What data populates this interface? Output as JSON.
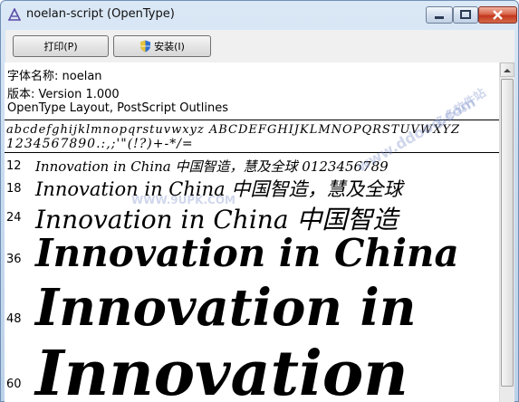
{
  "window": {
    "title": "noelan-script (OpenType)",
    "accent": "#c3361c"
  },
  "toolbar": {
    "print_label": "打印(P)",
    "install_label": "安装(I)"
  },
  "info": {
    "font_name": "字体名称: noelan",
    "version": "版本: Version 1.000",
    "tech": "OpenType Layout, PostScript Outlines"
  },
  "charset": {
    "line1": "abcdefghijklmnopqrstuvwxyz ABCDEFGHIJKLMNOPQRSTUVWXYZ",
    "line2": "1234567890.:,;'\"(!?)+-*/="
  },
  "samples": [
    {
      "size": "12",
      "text": "Innovation in China 中国智造，慧及全球 0123456789"
    },
    {
      "size": "18",
      "text": "Innovation in China 中国智造，慧及全球"
    },
    {
      "size": "24",
      "text": "Innovation in China 中国智造"
    },
    {
      "size": "36",
      "text": "Innovation in China"
    },
    {
      "size": "48",
      "text": "Innovation in"
    },
    {
      "size": "60",
      "text": "Innovation"
    }
  ],
  "watermarks": {
    "site1": "WWW.9UPK.COM",
    "site2": "www.ddooo.com",
    "site3": "多多软件站"
  }
}
